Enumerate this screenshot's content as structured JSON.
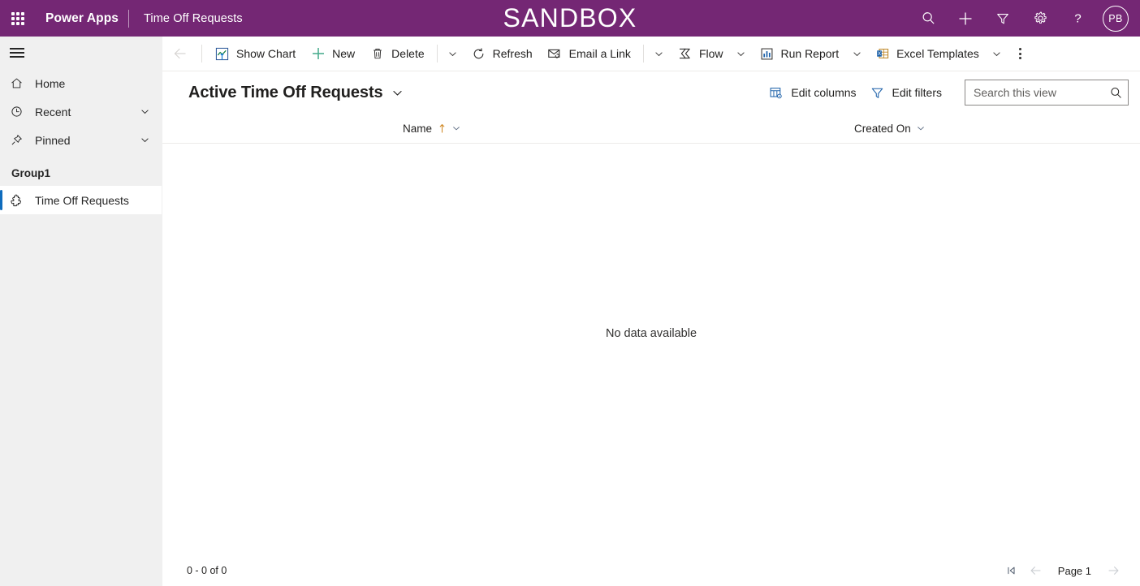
{
  "topbar": {
    "waffle_icon": "app-launcher-icon",
    "brand": "Power Apps",
    "app_name": "Time Off Requests",
    "environment_title": "SANDBOX",
    "icons": [
      {
        "name": "search-icon",
        "label": "Search"
      },
      {
        "name": "plus-icon",
        "label": "New"
      },
      {
        "name": "filter-icon",
        "label": "Filter"
      },
      {
        "name": "gear-icon",
        "label": "Settings"
      },
      {
        "name": "help-icon",
        "label": "Help"
      }
    ],
    "avatar_initials": "PB",
    "background_color": "#742774"
  },
  "sidebar": {
    "hamburger_icon": "hamburger-icon",
    "items": [
      {
        "label": "Home",
        "icon": "home-icon",
        "expandable": false
      },
      {
        "label": "Recent",
        "icon": "clock-icon",
        "expandable": true
      },
      {
        "label": "Pinned",
        "icon": "pin-icon",
        "expandable": true
      }
    ],
    "group_label": "Group1",
    "group_items": [
      {
        "label": "Time Off Requests",
        "icon": "puzzle-icon",
        "selected": true
      }
    ],
    "selected_accent_color": "#0f6cbd",
    "background_color": "#f0f0f0"
  },
  "commandbar": {
    "back_label": "Back",
    "buttons": [
      {
        "label": "Show Chart",
        "icon": "chart-icon",
        "chevron": false
      },
      {
        "label": "New",
        "icon": "plus-icon",
        "chevron": false
      },
      {
        "label": "Delete",
        "icon": "trash-icon",
        "chevron": true
      },
      {
        "label": "Refresh",
        "icon": "refresh-icon",
        "chevron": false
      },
      {
        "label": "Email a Link",
        "icon": "email-link-icon",
        "chevron": true
      },
      {
        "label": "Flow",
        "icon": "flow-icon",
        "chevron": true
      },
      {
        "label": "Run Report",
        "icon": "report-icon",
        "chevron": true
      },
      {
        "label": "Excel Templates",
        "icon": "excel-icon",
        "chevron": true
      }
    ],
    "overflow_label": "More commands"
  },
  "view": {
    "title": "Active Time Off Requests",
    "edit_columns_label": "Edit columns",
    "edit_filters_label": "Edit filters",
    "search_placeholder": "Search this view",
    "search_value": ""
  },
  "grid": {
    "columns": [
      {
        "label": "Name",
        "sorted": "ascending",
        "sort_color": "#d18b2c"
      },
      {
        "label": "Created On",
        "sorted": "none"
      }
    ],
    "empty_message": "No data available"
  },
  "footer": {
    "record_range": "0 - 0 of 0",
    "first_page_label": "First page",
    "previous_page_label": "Previous page",
    "page_label": "Page 1",
    "next_page_label": "Next page"
  }
}
